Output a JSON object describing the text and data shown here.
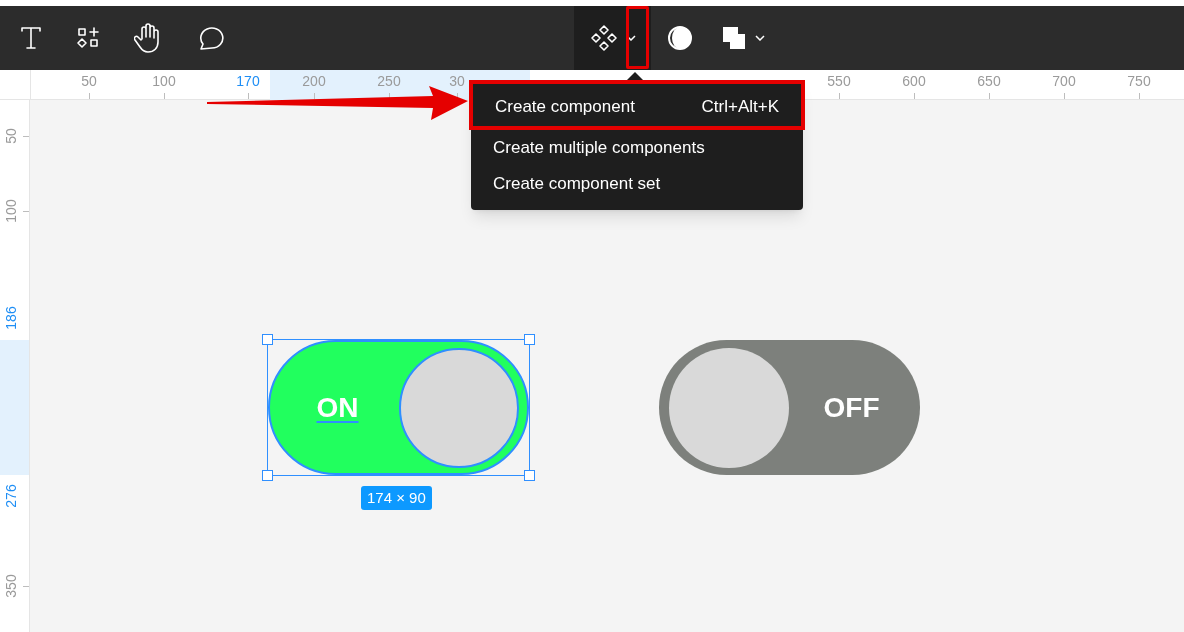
{
  "toolbar": {
    "tools": [
      {
        "kind": "text",
        "selected": false
      },
      {
        "kind": "shapes",
        "selected": false
      },
      {
        "kind": "hand",
        "selected": false
      },
      {
        "kind": "comment",
        "selected": false
      },
      {
        "kind": "component",
        "selected": true
      },
      {
        "kind": "contrast",
        "selected": false
      },
      {
        "kind": "boolean",
        "selected": false
      }
    ]
  },
  "ruler_top": {
    "ticks": [
      {
        "label": "50",
        "selected": false
      },
      {
        "label": "100",
        "selected": false
      },
      {
        "label": "170",
        "selected": true
      },
      {
        "label": "200",
        "selected": false
      },
      {
        "label": "250",
        "selected": false
      },
      {
        "label": "30",
        "selected": false
      },
      {
        "label": "550",
        "selected": false
      },
      {
        "label": "600",
        "selected": false
      },
      {
        "label": "650",
        "selected": false
      },
      {
        "label": "700",
        "selected": false
      },
      {
        "label": "750",
        "selected": false
      }
    ]
  },
  "ruler_left": {
    "ticks": [
      {
        "label": "50",
        "selected": false
      },
      {
        "label": "100",
        "selected": false
      },
      {
        "label": "186",
        "selected": true
      },
      {
        "label": "276",
        "selected": true
      },
      {
        "label": "350",
        "selected": false
      }
    ]
  },
  "menu": {
    "items": [
      {
        "label": "Create component",
        "shortcut": "Ctrl+Alt+K",
        "selected": true
      },
      {
        "label": "Create multiple components",
        "selected": false
      },
      {
        "label": "Create component set",
        "selected": false
      }
    ]
  },
  "toggles": [
    {
      "label": "ON",
      "on": true,
      "selected": true
    },
    {
      "label": "OFF",
      "on": false,
      "selected": false
    }
  ],
  "selection_size": "174 × 90"
}
